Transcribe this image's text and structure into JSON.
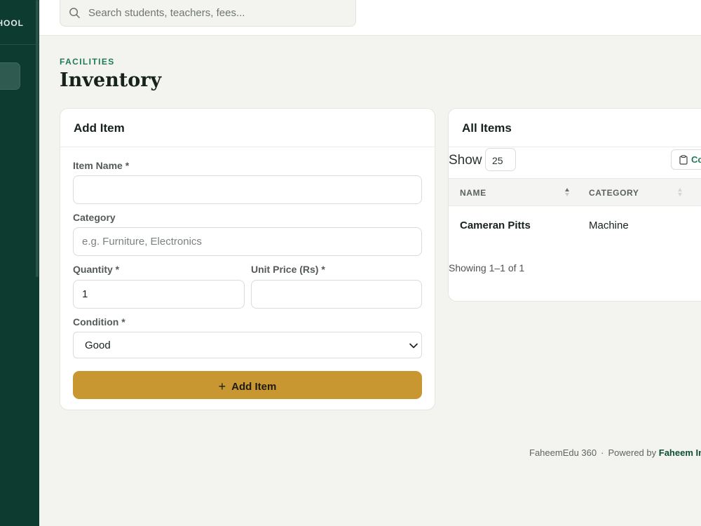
{
  "sidebar": {
    "brand_fragment": "HOOL"
  },
  "search": {
    "placeholder": "Search students, teachers, fees..."
  },
  "page": {
    "eyebrow": "FACILITIES",
    "title": "Inventory"
  },
  "add_form": {
    "title": "Add Item",
    "item_name": {
      "label": "Item Name *",
      "value": ""
    },
    "category": {
      "label": "Category",
      "placeholder": "e.g. Furniture, Electronics",
      "value": ""
    },
    "quantity": {
      "label": "Quantity *",
      "value": "1"
    },
    "unit_price": {
      "label": "Unit Price (Rs) *",
      "value": ""
    },
    "condition": {
      "label": "Condition *",
      "value": "Good"
    },
    "submit_label": "Add Item"
  },
  "list": {
    "title": "All Items",
    "show_label": "Show",
    "page_size": "25",
    "copy_label": "Co",
    "columns": [
      "NAME",
      "CATEGORY"
    ],
    "rows": [
      {
        "name": "Cameran Pitts",
        "category": "Machine"
      }
    ],
    "summary": "Showing 1–1 of 1"
  },
  "footer": {
    "app": "FaheemEdu 360",
    "powered_prefix": "Powered by",
    "powered_brand": "Faheem In"
  },
  "colors": {
    "sidebar": "#0d3b30",
    "accent_green": "#1f7a55",
    "button_gold": "#c99732",
    "background": "#f3f3f0"
  },
  "icons": [
    "search-icon",
    "plus-icon",
    "chevron-down-icon",
    "clipboard-icon",
    "sort-icon"
  ]
}
